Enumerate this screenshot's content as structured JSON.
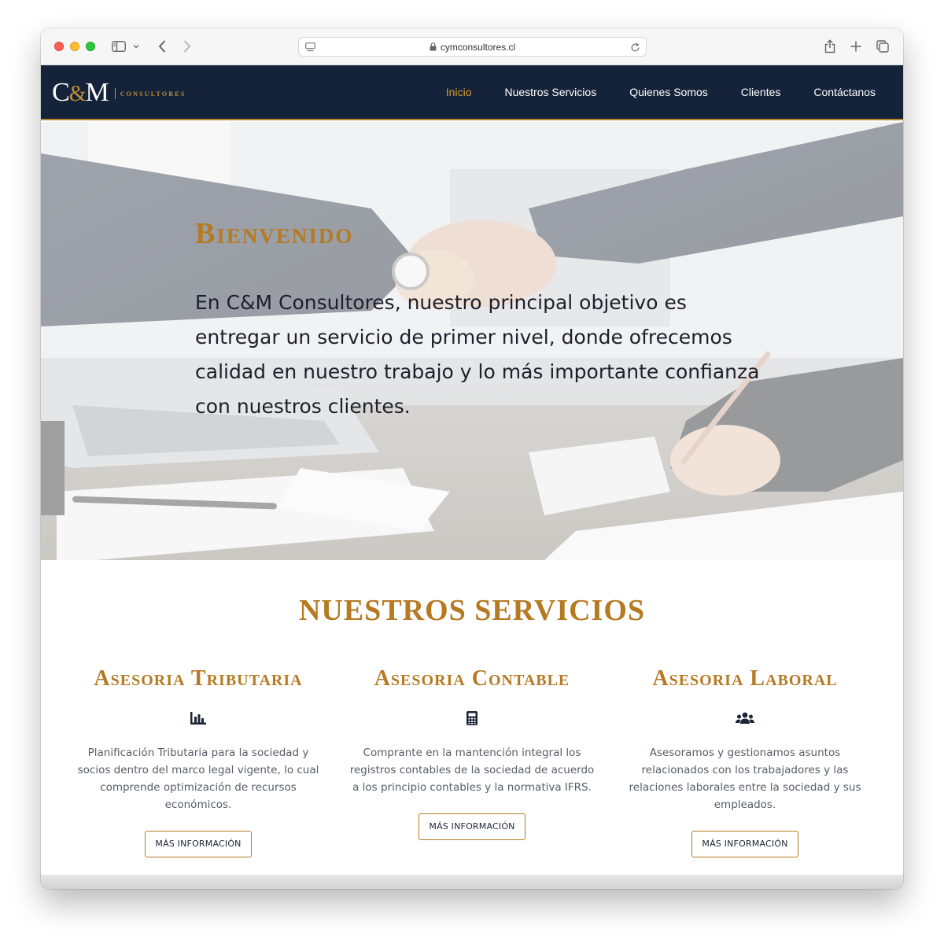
{
  "browser": {
    "url": "cymconsultores.cl",
    "icons": [
      "sidebar-icon",
      "chevron-down-icon",
      "back-arrow-icon",
      "forward-arrow-icon",
      "reader-icon",
      "lock-icon",
      "reload-icon",
      "share-icon",
      "plus-icon",
      "tabs-icon"
    ],
    "traffic_colors": {
      "close": "#fe5f57",
      "minimize": "#febc2e",
      "zoom": "#28c840"
    }
  },
  "nav": {
    "logo_main_c": "C",
    "logo_amp": "&",
    "logo_main_m": "M",
    "logo_sub": "CONSULTORES",
    "items": [
      {
        "label": "Inicio",
        "active": true
      },
      {
        "label": "Nuestros Servicios",
        "active": false
      },
      {
        "label": "Quienes Somos",
        "active": false
      },
      {
        "label": "Clientes",
        "active": false
      },
      {
        "label": "Contáctanos",
        "active": false
      }
    ],
    "bg_color": "#15233a",
    "accent_color": "#d39a2f"
  },
  "hero": {
    "title": "Bienvenido",
    "text": "En C&M Consultores, nuestro principal objetivo es entregar un servicio de primer nivel, donde ofrecemos calidad en nuestro trabajo y lo más importante confianza con nuestros clientes."
  },
  "services": {
    "title": "NUESTROS SERVICIOS",
    "items": [
      {
        "title": "Asesoria Tributaria",
        "icon": "bar-chart-icon",
        "description": "Planificación Tributaria para la sociedad y socios dentro del marco legal vigente, lo cual comprende optimización de recursos económicos.",
        "button": "MÁS INFORMACIÓN"
      },
      {
        "title": "Asesoria Contable",
        "icon": "calculator-icon",
        "description": "Comprante en la mantención integral los registros contables de la sociedad de acuerdo a los principio contables y la normativa IFRS.",
        "button": "MÁS INFORMACIÓN"
      },
      {
        "title": "Asesoria Laboral",
        "icon": "users-icon",
        "description": "Asesoramos y gestionamos asuntos relacionados con los trabajadores y las relaciones laborales entre la sociedad y sus empleados.",
        "button": "MÁS INFORMACIÓN"
      }
    ],
    "accent_color": "#b57a22"
  }
}
